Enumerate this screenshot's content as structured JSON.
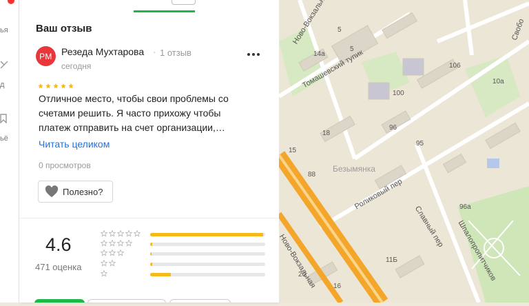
{
  "sidebar": {
    "items": [
      {
        "label": "ья",
        "icon": "star-icon"
      },
      {
        "label": "д",
        "icon": "route-icon"
      },
      {
        "label": "ьё",
        "icon": "bookmark-icon"
      }
    ]
  },
  "tabs": {
    "active_color": "#1db948"
  },
  "review_section": {
    "title": "Ваш отзыв",
    "author": {
      "initials": "РМ",
      "name": "Резеда Мухтарова",
      "separator": "·",
      "reviews_count": "1 отзыв",
      "date": "сегодня"
    },
    "rating": 5,
    "text_lines": [
      "Отличное место, чтобы свои проблемы со",
      "счетами решить. Я часто прихожу чтобы",
      "платеж отправить на счет организации,…"
    ],
    "read_more": "Читать целиком",
    "views": "0 просмотров",
    "useful_button": "Полезно?"
  },
  "rating_summary": {
    "score": "4.6",
    "count_label": "471 оценка",
    "distribution": [
      {
        "stars": 5,
        "fraction": 0.98
      },
      {
        "stars": 4,
        "fraction": 0.02
      },
      {
        "stars": 3,
        "fraction": 0.01
      },
      {
        "stars": 2,
        "fraction": 0.02
      },
      {
        "stars": 1,
        "fraction": 0.18
      }
    ]
  },
  "map": {
    "labels": [
      {
        "text": "Ново-Вокзальный тупик",
        "name": "street-novo-vokzalny-tupik"
      },
      {
        "text": "Томашевский тупик",
        "name": "street-tomashevsky-tupik"
      },
      {
        "text": "Безымянка",
        "name": "district-bezymyanka"
      },
      {
        "text": "Роликовый пер",
        "name": "street-rolikovy-per"
      },
      {
        "text": "Славный пер",
        "name": "street-slavny-per"
      },
      {
        "text": "Ново-Вокзальная",
        "name": "street-novo-vokzalnaya"
      },
      {
        "text": "Шпалопропитчиков",
        "name": "street-shpalopropitchikov"
      },
      {
        "text": "Свобо",
        "name": "street-svobody"
      }
    ],
    "house_numbers": [
      "14а",
      "5",
      "106",
      "10а",
      "100",
      "18",
      "96",
      "95",
      "88",
      "15",
      "5",
      "96а",
      "11Б",
      "20",
      "16"
    ]
  },
  "colors": {
    "accent": "#1db948",
    "star": "#f6b91a",
    "link": "#1a73e8",
    "avatar": "#e8363a",
    "road": "#f4a62a"
  }
}
